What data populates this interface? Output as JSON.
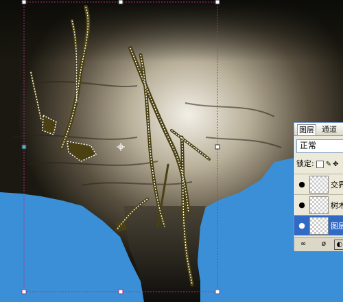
{
  "layers_panel": {
    "tabs": [
      "图层",
      "通道"
    ],
    "blend_mode": "正常",
    "lock_label": "锁定:",
    "lock_icons": [
      "lock-transparent-icon",
      "lock-paint-icon",
      "lock-move-icon"
    ],
    "layers": [
      {
        "name": "交界",
        "visible": true,
        "selected": false
      },
      {
        "name": "树木",
        "visible": true,
        "selected": false
      },
      {
        "name": "图层",
        "visible": true,
        "selected": true
      }
    ],
    "footer_icons": [
      "link-icon",
      "fx-icon",
      "mask-icon"
    ]
  },
  "colors": {
    "sky_blue": "#3a8fd6",
    "rock_dark": "#1c1a12",
    "rock_light": "#e8e4d8",
    "branch": "#4a4012",
    "selection": "#b03080"
  }
}
